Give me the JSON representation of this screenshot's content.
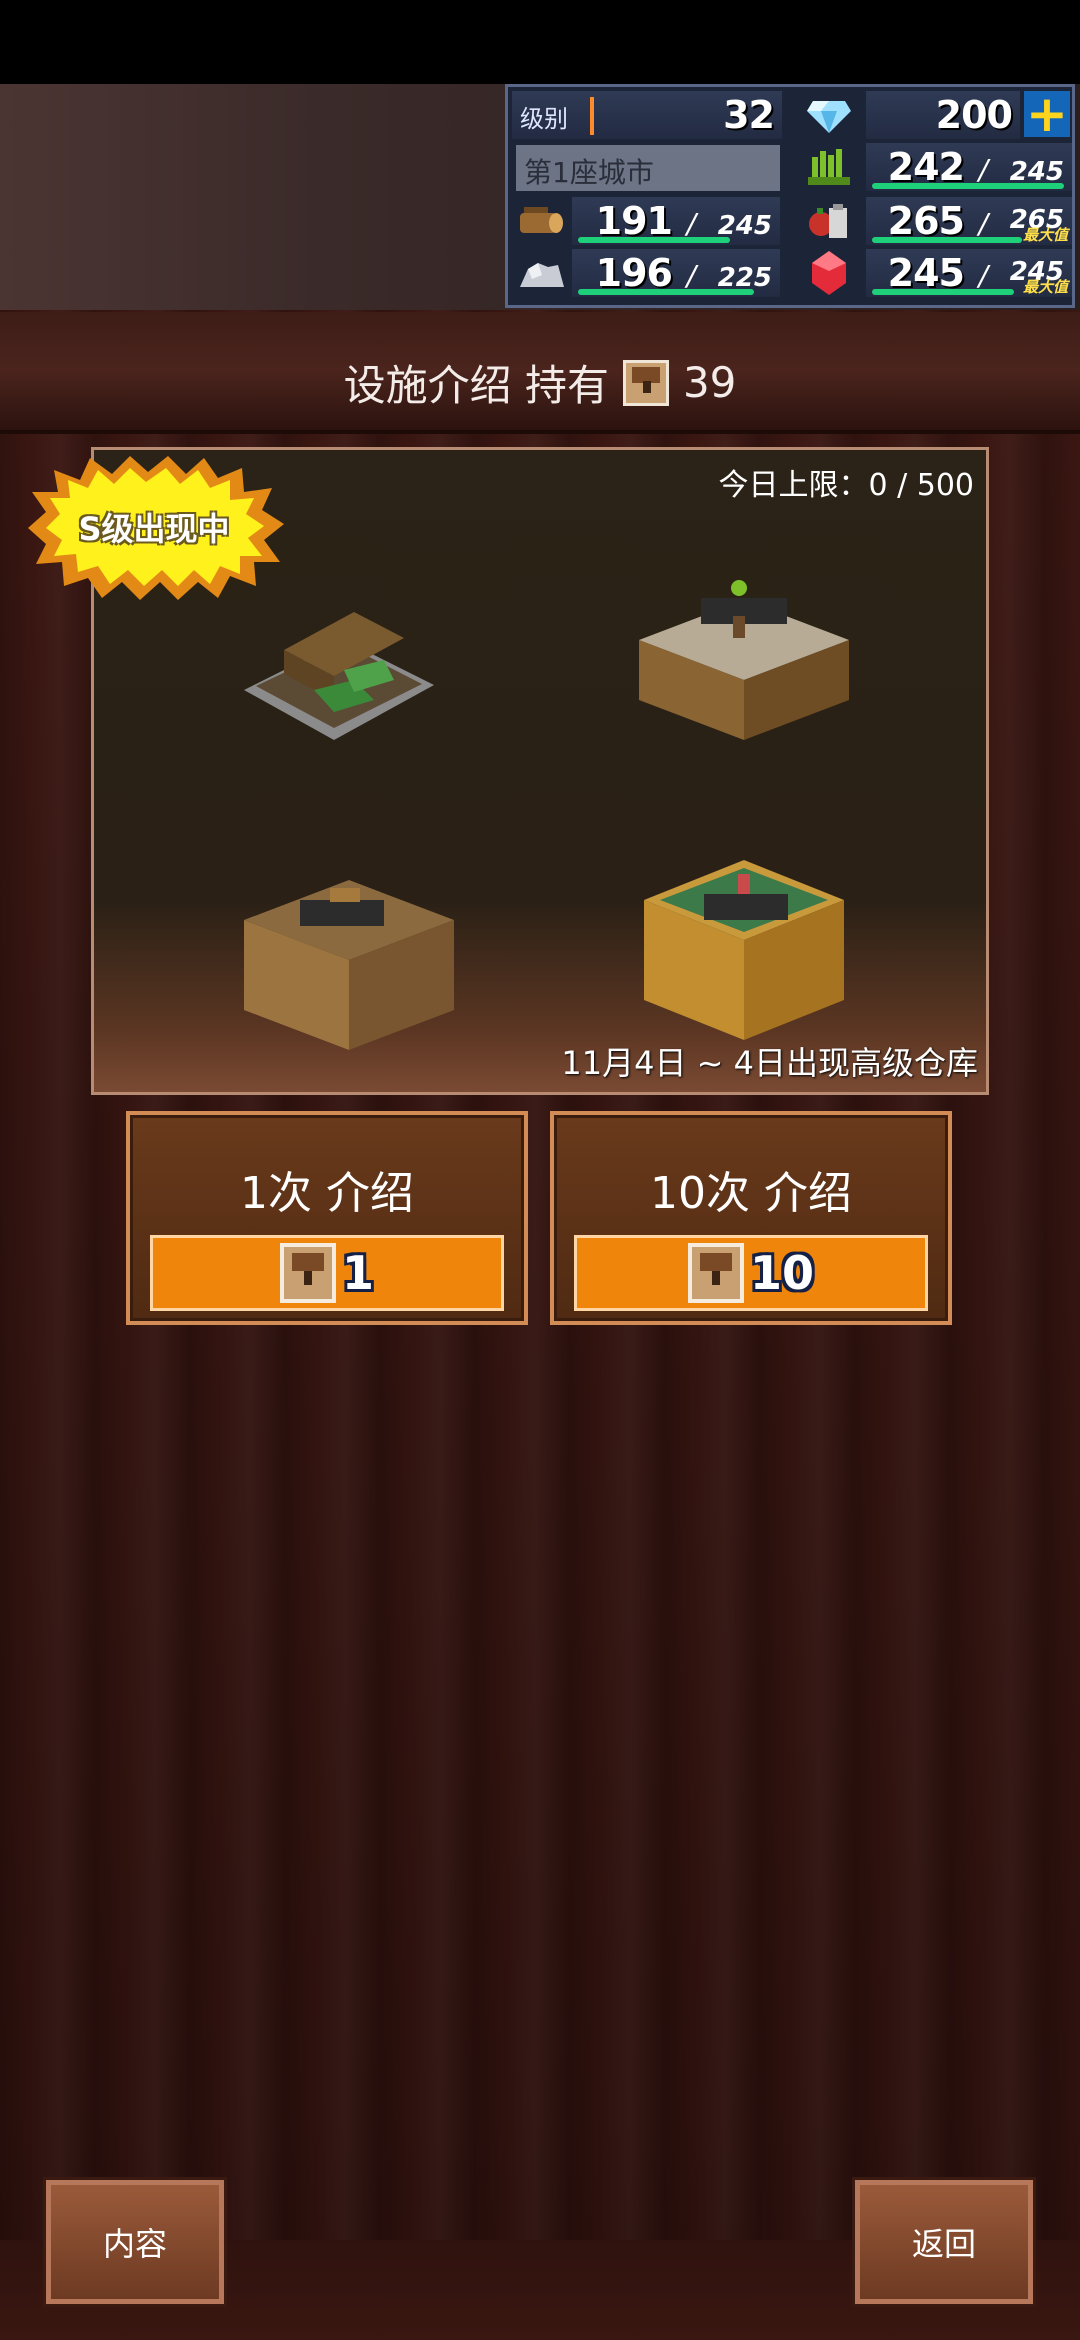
{
  "hud": {
    "level_label": "级别",
    "level": "32",
    "gems": "200",
    "city_name": "第1座城市",
    "resources": [
      {
        "icon": "grass-icon",
        "value": "242",
        "max": "245",
        "fill": 0.99,
        "max_tag": ""
      },
      {
        "icon": "wood-log-icon",
        "value": "191",
        "max": "245",
        "fill": 0.78,
        "max_tag": ""
      },
      {
        "icon": "food-icon",
        "value": "265",
        "max": "265",
        "fill": 1.0,
        "max_tag": "最大值"
      },
      {
        "icon": "stone-icon",
        "value": "196",
        "max": "225",
        "fill": 0.87,
        "max_tag": ""
      },
      {
        "icon": "ruby-icon",
        "value": "245",
        "max": "245",
        "fill": 1.0,
        "max_tag": "最大值"
      }
    ]
  },
  "header": {
    "title": "设施介绍 持有",
    "owned_count": "39"
  },
  "banner": {
    "daily_limit": "今日上限：0 / 500",
    "badge": "S级出现中",
    "caption": "11月4日 ~ 4日出现高级仓库"
  },
  "buttons": {
    "single_label": "1次 介绍",
    "single_cost": "1",
    "multi_label": "10次 介绍",
    "multi_cost": "10"
  },
  "nav": {
    "contents": "内容",
    "back": "返回"
  },
  "colors": {
    "accent_orange": "#ef860b",
    "bar_green": "#1fd07a",
    "hud_bg": "#1c2438"
  }
}
